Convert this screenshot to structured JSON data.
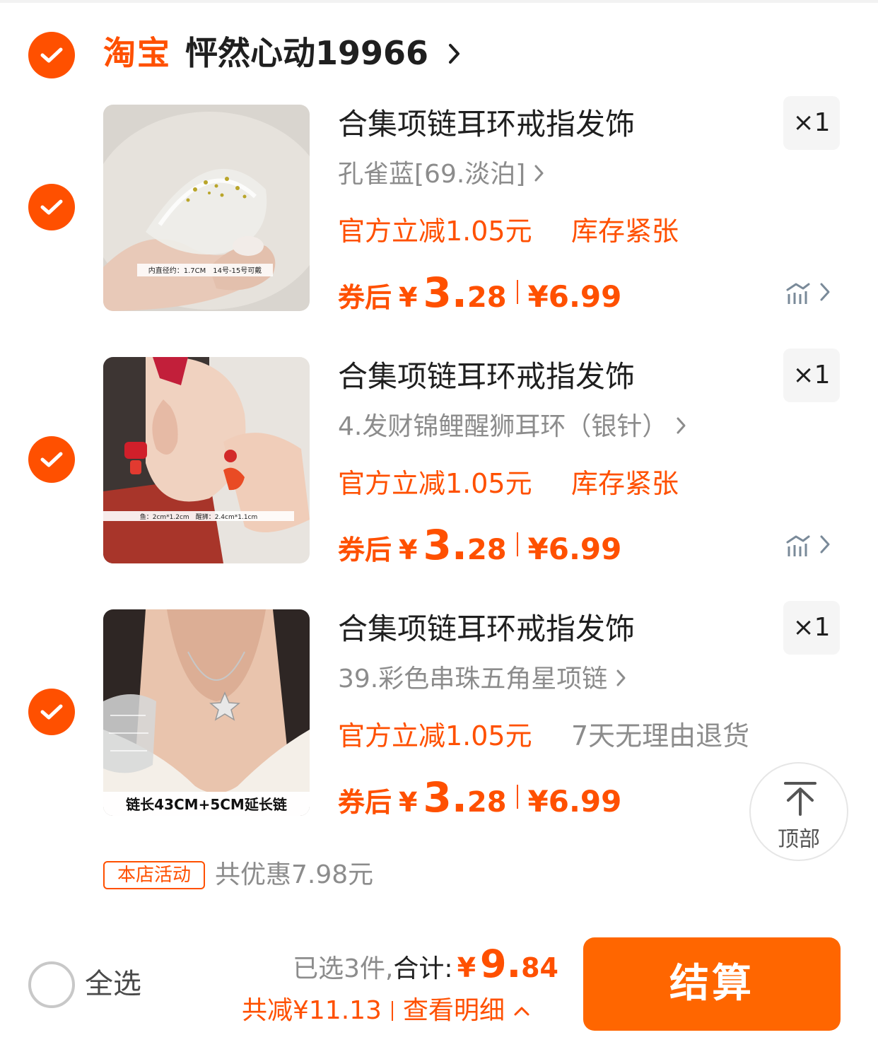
{
  "shop": {
    "logo": "淘宝",
    "name": "怦然心动19966"
  },
  "items": [
    {
      "title": "合集项链耳环戒指发饰",
      "qty": "×1",
      "sku": "孔雀蓝[69.淡泊]",
      "promo": "官方立减1.05元",
      "tag": "库存紧张",
      "coupon_label": "券后",
      "price_yen": "¥",
      "price_int": "3.",
      "price_dec": "28",
      "original_price": "¥6.99",
      "image_caption": "内直径约：1.7CM　14号-15号可戴"
    },
    {
      "title": "合集项链耳环戒指发饰",
      "qty": "×1",
      "sku": "4.发财锦鲤醒狮耳环（银针）",
      "promo": "官方立减1.05元",
      "tag": "库存紧张",
      "coupon_label": "券后",
      "price_yen": "¥",
      "price_int": "3.",
      "price_dec": "28",
      "original_price": "¥6.99",
      "image_caption": "鱼：2cm*1.2cm　醒狮：2.4cm*1.1cm"
    },
    {
      "title": "合集项链耳环戒指发饰",
      "qty": "×1",
      "sku": "39.彩色串珠五角星项链",
      "promo": "官方立减1.05元",
      "tag": "7天无理由退货",
      "coupon_label": "券后",
      "price_yen": "¥",
      "price_int": "3.",
      "price_dec": "28",
      "original_price": "¥6.99",
      "image_caption": "链长43CM+5CM延长链"
    }
  ],
  "activity": {
    "tag": "本店活动",
    "text": "共优惠7.98元"
  },
  "to_top": {
    "label": "顶部"
  },
  "bottom": {
    "select_all": "全选",
    "selected_count": "已选3件,",
    "total_label": "合计:",
    "total_yen": "¥",
    "total_int": "9.",
    "total_dec": "84",
    "saved": "共减¥11.13",
    "details": "查看明细",
    "checkout": "结算"
  },
  "colors": {
    "accent": "#ff5000",
    "checkout_button": "#ff6600",
    "muted_text": "#8c8c8c"
  }
}
